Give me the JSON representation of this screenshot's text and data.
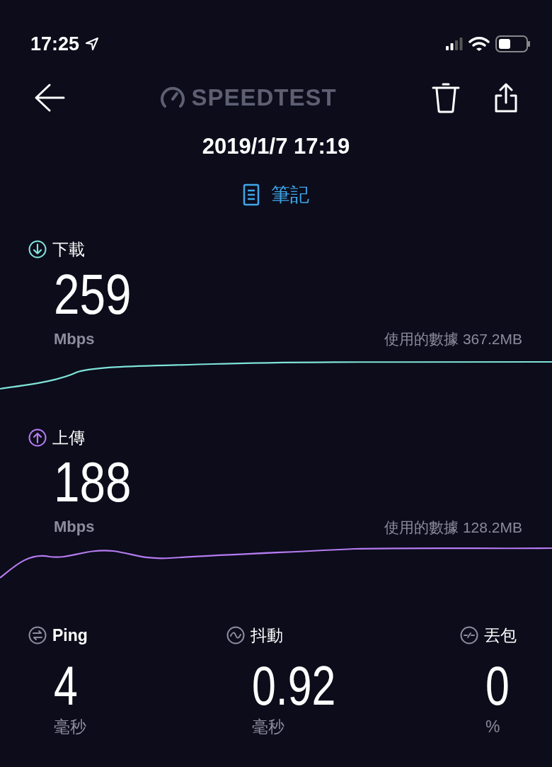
{
  "status_bar": {
    "time": "17:25"
  },
  "header": {
    "logo": "SPEEDTEST",
    "date": "2019/1/7 17:19",
    "notes_link": "筆記"
  },
  "tests": [
    {
      "kind": "download",
      "label": "下載",
      "value": "259",
      "unit": "Mbps",
      "data_used": "使用的數據 367.2MB",
      "color": "#7fe3d8"
    },
    {
      "kind": "upload",
      "label": "上傳",
      "value": "188",
      "unit": "Mbps",
      "data_used": "使用的數據 128.2MB",
      "color": "#b57bf0"
    }
  ],
  "metrics": [
    {
      "kind": "ping",
      "label": "Ping",
      "value": "4",
      "unit": "毫秒"
    },
    {
      "kind": "jitter",
      "label": "抖動",
      "value": "0.92",
      "unit": "毫秒"
    },
    {
      "kind": "loss",
      "label": "丟包",
      "value": "0",
      "unit": "%"
    }
  ]
}
